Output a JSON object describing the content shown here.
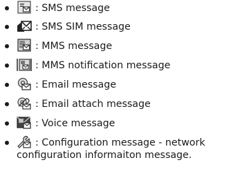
{
  "items": [
    {
      "icon": "sms-message-icon",
      "label": ": SMS message"
    },
    {
      "icon": "sms-sim-message-icon",
      "label": ": SMS SIM message"
    },
    {
      "icon": "mms-message-icon",
      "label": ": MMS message"
    },
    {
      "icon": "mms-notification-icon",
      "label": ": MMS notification message"
    },
    {
      "icon": "email-message-icon",
      "label": ": Email message"
    },
    {
      "icon": "email-attach-icon",
      "label": ": Email attach message"
    },
    {
      "icon": "voice-message-icon",
      "label": ": Voice message"
    },
    {
      "icon": "configuration-message-icon",
      "label": ": Configuration message - network",
      "label_cont": "configuration informaiton message."
    }
  ]
}
